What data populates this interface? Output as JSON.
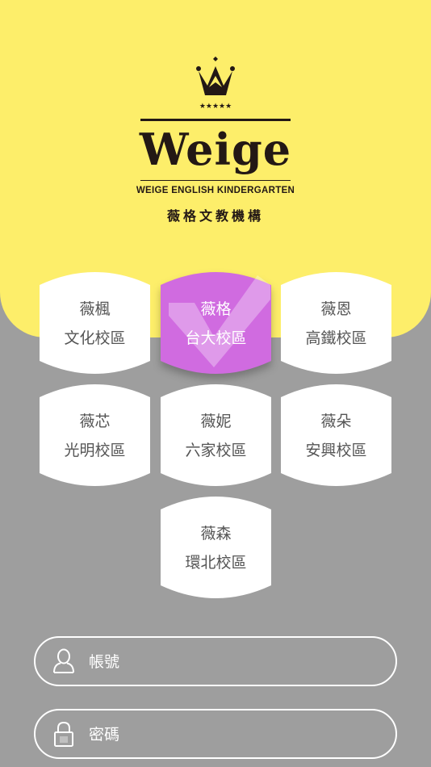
{
  "logo": {
    "brand": "Weige",
    "subtitle": "WEIGE ENGLISH KINDERGARTEN",
    "chinese_name": "薇格文教機構",
    "stars": "★★★★★"
  },
  "campuses": [
    {
      "name": "薇楓",
      "area": "文化校區",
      "selected": false
    },
    {
      "name": "薇格",
      "area": "台大校區",
      "selected": true
    },
    {
      "name": "薇恩",
      "area": "高鐵校區",
      "selected": false
    },
    {
      "name": "薇芯",
      "area": "光明校區",
      "selected": false
    },
    {
      "name": "薇妮",
      "area": "六家校區",
      "selected": false
    },
    {
      "name": "薇朵",
      "area": "安興校區",
      "selected": false
    },
    {
      "name": "薇森",
      "area": "環北校區",
      "selected": false
    }
  ],
  "login": {
    "account_placeholder": "帳號",
    "password_placeholder": "密碼"
  },
  "colors": {
    "header_yellow": "#fdee6a",
    "background_gray": "#9e9e9e",
    "selected_purple": "#d06be0"
  }
}
